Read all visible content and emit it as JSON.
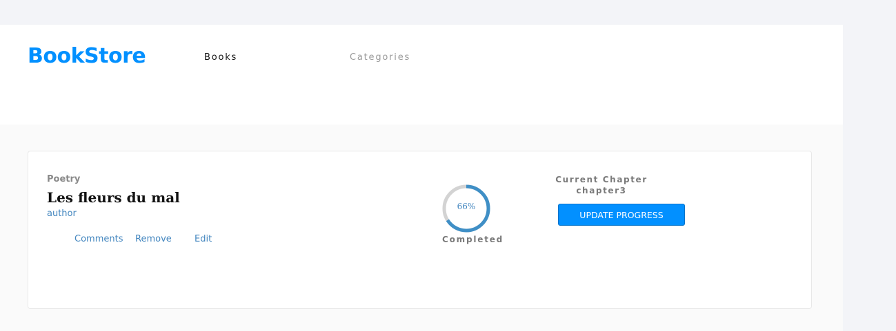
{
  "header": {
    "logo": "BookStore",
    "nav": {
      "books": "Books",
      "categories": "Categories"
    }
  },
  "book": {
    "genre": "Poetry",
    "title": "Les fleurs du mal",
    "author": "author",
    "actions": {
      "comments": "Comments",
      "remove": "Remove",
      "edit": "Edit"
    },
    "progress": {
      "percent": 66,
      "percent_label": "66%",
      "status": "Completed"
    },
    "chapter": {
      "label": "Current Chapter",
      "value": "chapter3"
    },
    "update_button": "UPDATE PROGRESS"
  },
  "colors": {
    "accent": "#0290ff",
    "link": "#4386bf",
    "progress_track": "#d3d3d3",
    "progress_fill": "#3f8fc6"
  }
}
